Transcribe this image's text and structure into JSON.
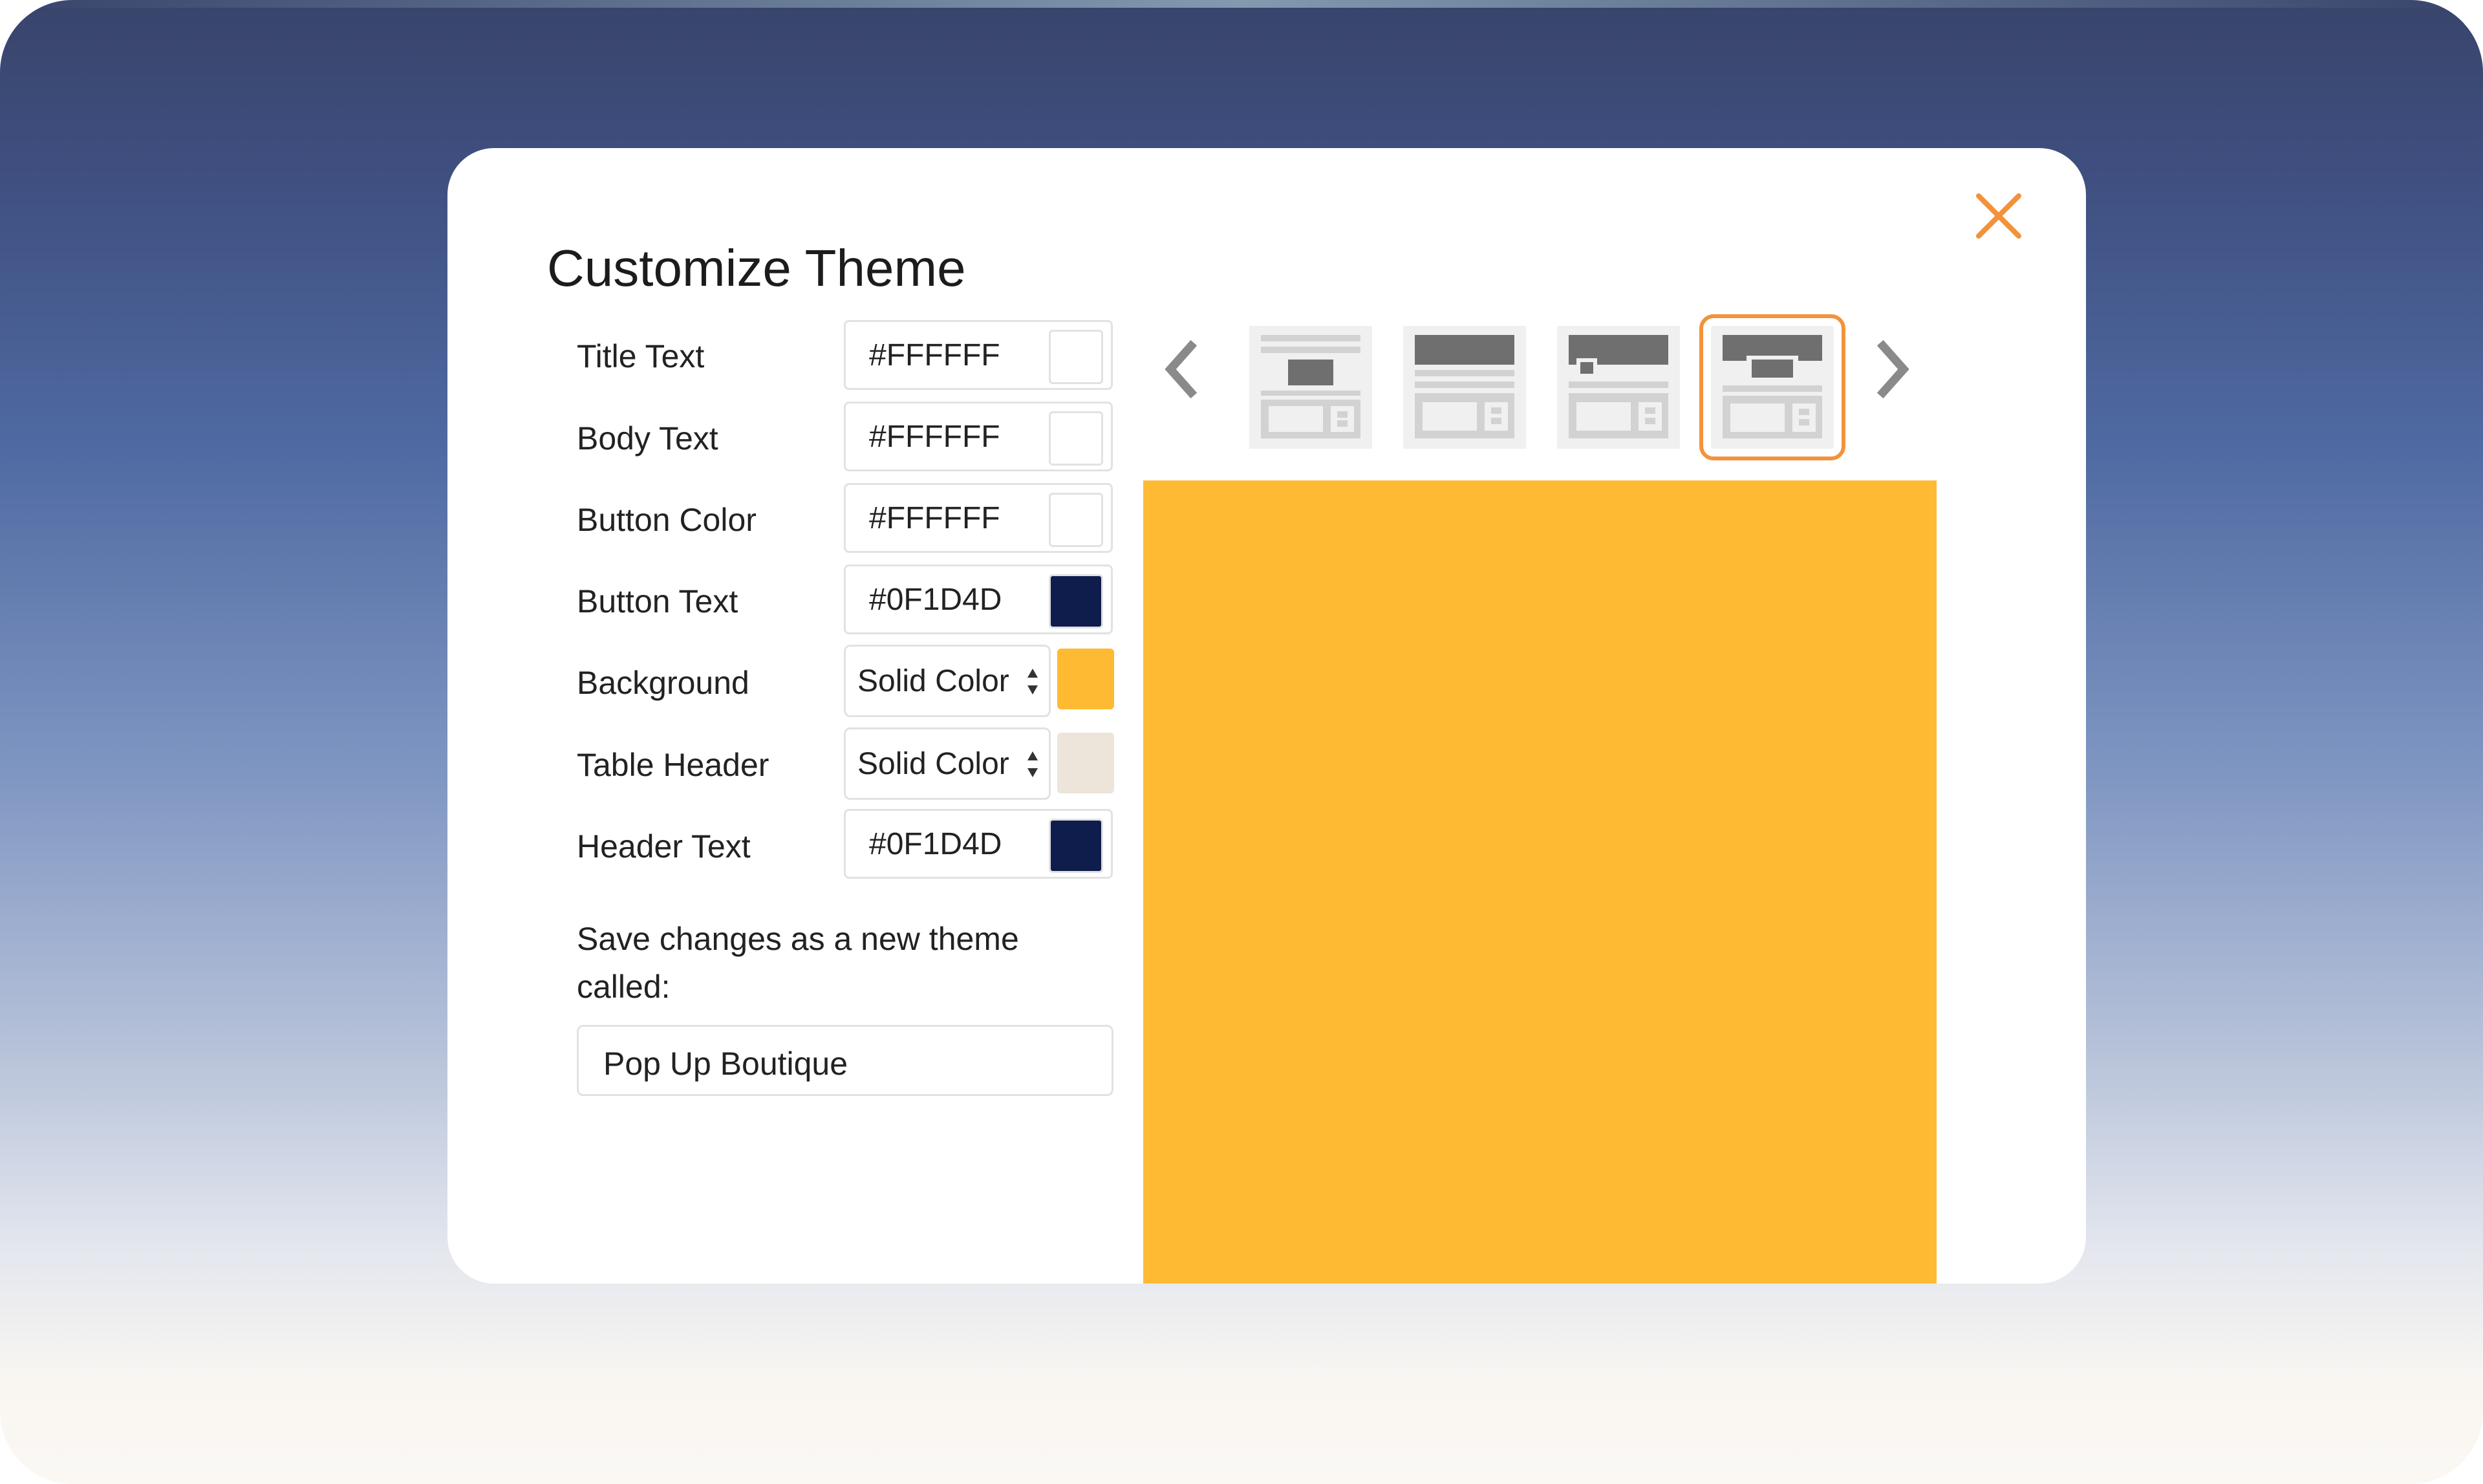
{
  "colors": {
    "accent": "#f3923b",
    "preview_background": "#FFBA33"
  },
  "modal": {
    "title": "Customize Theme",
    "close_icon": "close-icon"
  },
  "settings": [
    {
      "label": "Title Text",
      "value": "#FFFFFF",
      "swatch": "#FFFFFF"
    },
    {
      "label": "Body Text",
      "value": "#FFFFFF",
      "swatch": "#FFFFFF"
    },
    {
      "label": "Button Color",
      "value": "#FFFFFF",
      "swatch": "#FFFFFF"
    },
    {
      "label": "Button Text",
      "value": "#0F1D4D",
      "swatch": "#0F1D4D"
    }
  ],
  "background": {
    "label": "Background",
    "select_value": "Solid Color",
    "swatch": "#FFBA33"
  },
  "table_header": {
    "label": "Table Header",
    "select_value": "Solid Color",
    "swatch": "#EDE4DA"
  },
  "header_text": {
    "label": "Header Text",
    "value": "#0F1D4D",
    "swatch": "#0F1D4D"
  },
  "save": {
    "prompt": "Save changes as a new theme called:",
    "theme_name": "Pop Up Boutique"
  },
  "layouts": {
    "prev_icon": "chevron-left-icon",
    "next_icon": "chevron-right-icon",
    "selected_index": 3,
    "count": 4
  }
}
